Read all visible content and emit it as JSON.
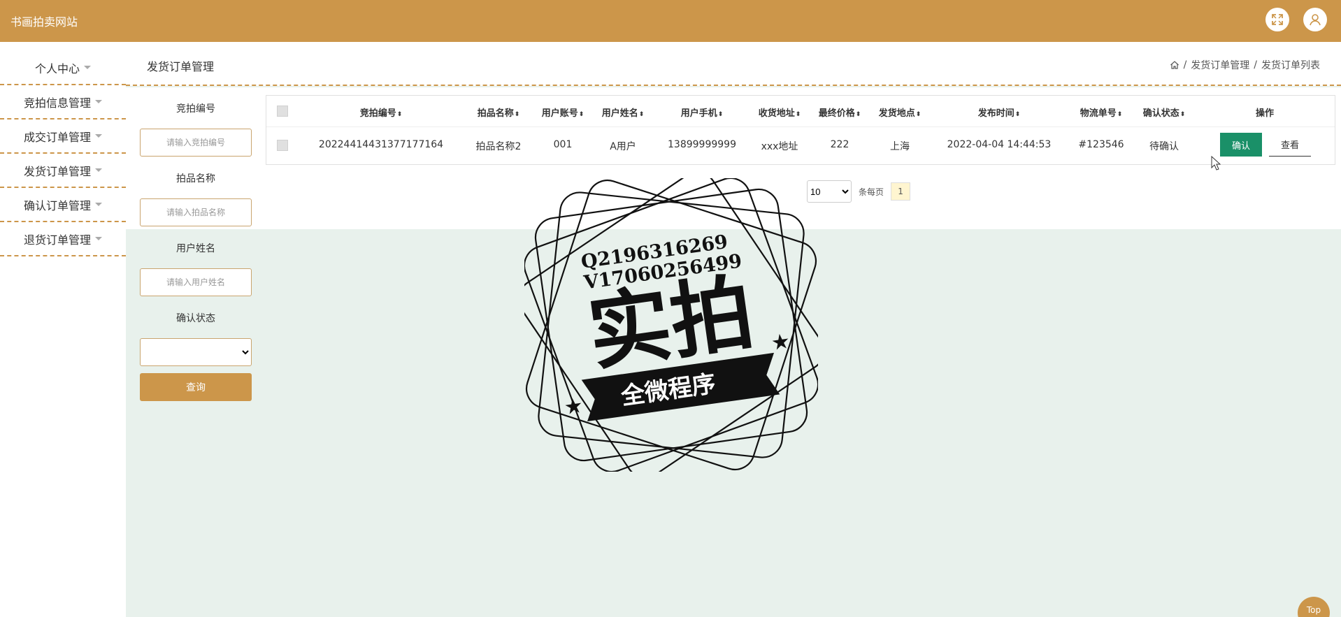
{
  "app": {
    "title": "书画拍卖网站"
  },
  "sidebar": {
    "items": [
      {
        "label": "个人中心"
      },
      {
        "label": "竞拍信息管理"
      },
      {
        "label": "成交订单管理"
      },
      {
        "label": "发货订单管理"
      },
      {
        "label": "确认订单管理"
      },
      {
        "label": "退货订单管理"
      }
    ]
  },
  "header": {
    "title": "发货订单管理",
    "breadcrumb": {
      "level1": "发货订单管理",
      "level2": "发货订单列表"
    }
  },
  "filters": {
    "bid_no": {
      "label": "竞拍编号",
      "placeholder": "请输入竞拍编号"
    },
    "item_name": {
      "label": "拍品名称",
      "placeholder": "请输入拍品名称"
    },
    "user_name": {
      "label": "用户姓名",
      "placeholder": "请输入用户姓名"
    },
    "confirm_status": {
      "label": "确认状态",
      "value": ""
    },
    "search_label": "查询"
  },
  "table": {
    "columns": [
      "竞拍编号",
      "拍品名称",
      "用户账号",
      "用户姓名",
      "用户手机",
      "收货地址",
      "最终价格",
      "发货地点",
      "发布时间",
      "物流单号",
      "确认状态",
      "操作"
    ],
    "rows": [
      [
        "20224414431377177164",
        "拍品名称2",
        "001",
        "A用户",
        "13899999999",
        "xxx地址",
        "222",
        "上海",
        "2022-04-04 14:44:53",
        "#123546",
        "待确认"
      ]
    ],
    "actions": {
      "confirm": "确认",
      "view": "查看"
    }
  },
  "pagination": {
    "page_size": "10",
    "per_page_label": "条每页",
    "current_page": "1"
  },
  "watermark": {
    "line1": "Q2196316269",
    "line2": "V17060256499",
    "big": "实拍",
    "ribbon": "全微程序"
  },
  "fab": {
    "label": "Top"
  },
  "colors": {
    "primary": "#cc964a",
    "confirm": "#1a9068",
    "bg": "#e8f1ec"
  }
}
